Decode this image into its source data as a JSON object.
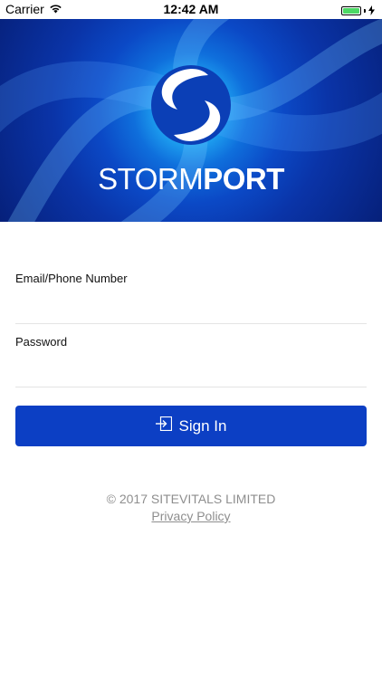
{
  "status_bar": {
    "carrier": "Carrier",
    "time": "12:42 AM",
    "icons": [
      "wifi-icon",
      "battery-icon",
      "charging-icon"
    ]
  },
  "header": {
    "brand_light": "STORM",
    "brand_bold": "PORT",
    "logo_icon": "swirl-logo"
  },
  "form": {
    "email_label": "Email/Phone Number",
    "email_value": "",
    "password_label": "Password",
    "password_value": ""
  },
  "signin": {
    "label": "Sign In",
    "icon": "sign-in-icon",
    "color": "#0c3fc4"
  },
  "footer": {
    "copyright": "© 2017 SITEVITALS LIMITED",
    "privacy_link": "Privacy Policy"
  }
}
